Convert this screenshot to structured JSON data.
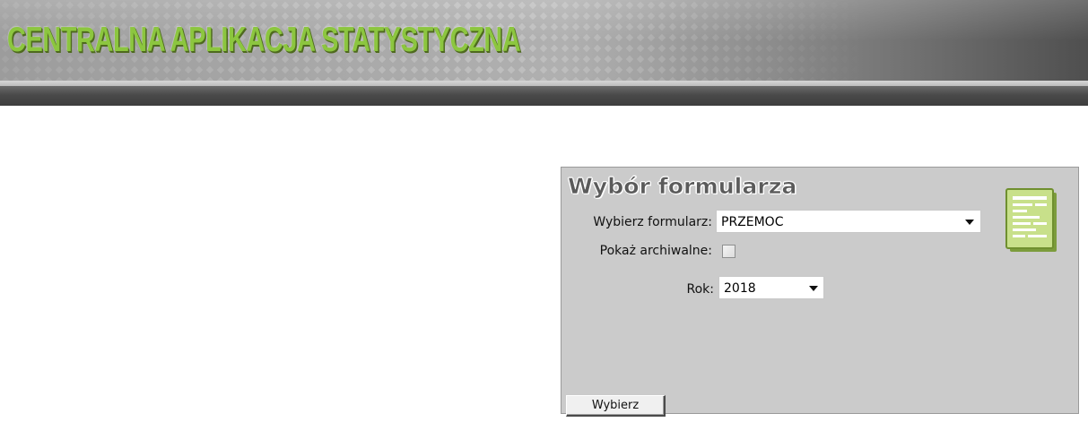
{
  "header": {
    "app_title": "CENTRALNA APLIKACJA STATYSTYCZNA"
  },
  "panel": {
    "title": "Wybór formularza",
    "icon": "form-document-icon",
    "form_select": {
      "label": "Wybierz formularz:",
      "value": "PRZEMOC"
    },
    "archive_checkbox": {
      "label": "Pokaż archiwalne:",
      "checked": false
    },
    "year_select": {
      "label": "Rok:",
      "value": "2018"
    },
    "submit_label": "Wybierz"
  },
  "colors": {
    "title_green": "#8cc63f",
    "panel_bg": "#cbcbcb",
    "banner_dark": "#3d3d3d"
  }
}
